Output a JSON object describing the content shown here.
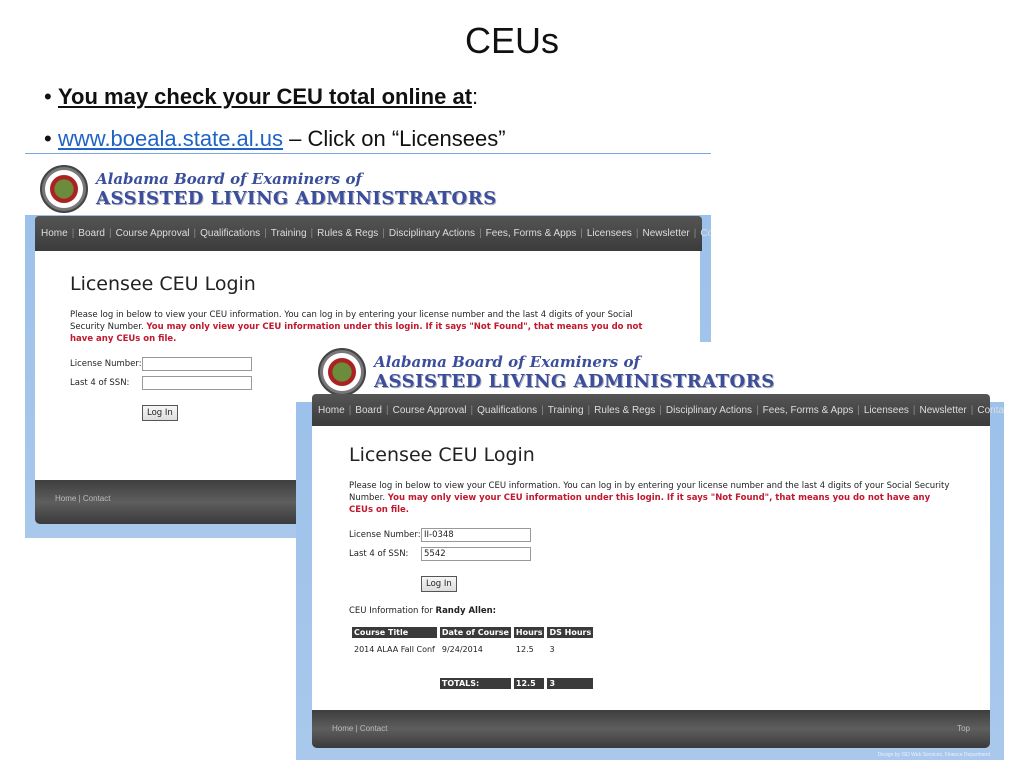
{
  "slide": {
    "title": "CEUs",
    "bullet1_bold": "You may check your CEU total online at",
    "bullet1_tail": ":",
    "bullet2_link": "www.boeala.state.al.us",
    "bullet2_tail": " – Click on “Licensees”"
  },
  "site": {
    "logo_line1": "Alabama Board of Examiners of",
    "logo_line2": "ASSISTED LIVING ADMINISTRATORS",
    "nav": [
      "Home",
      "Board",
      "Course Approval",
      "Qualifications",
      "Training",
      "Rules & Regs",
      "Disciplinary Actions",
      "Fees, Forms & Apps",
      "Licensees",
      "Newsletter",
      "Contact"
    ],
    "page_title": "Licensee CEU Login",
    "intro": "Please log in below to view your CEU information.  You can log in by entering your license number and the last 4 digits of your Social Security Number. ",
    "warning": "You may only view your CEU information under this login. If it says \"Not Found\", that means you do not have any CEUs on file.",
    "license_label": "License Number:",
    "ssn_label": "Last 4 of SSN:",
    "login_button": "Log In",
    "footer_home": "Home",
    "footer_sep": "|",
    "footer_contact": "Contact",
    "footer_top": "Top",
    "credit": "Design by ISD Web Services, Finance Department"
  },
  "shot2": {
    "license_value": "II-0348",
    "ssn_value": "5542",
    "ceu_info_prefix": "CEU Information for ",
    "ceu_name": "Randy Allen:",
    "table": {
      "headers": [
        "Course Title",
        "Date of Course",
        "Hours",
        "DS Hours"
      ],
      "rows": [
        [
          "2014 ALAA Fall Conf",
          "9/24/2014",
          "12.5",
          "3"
        ]
      ],
      "totals_label": "TOTALS:",
      "total_hours": "12.5",
      "total_ds": "3"
    }
  }
}
